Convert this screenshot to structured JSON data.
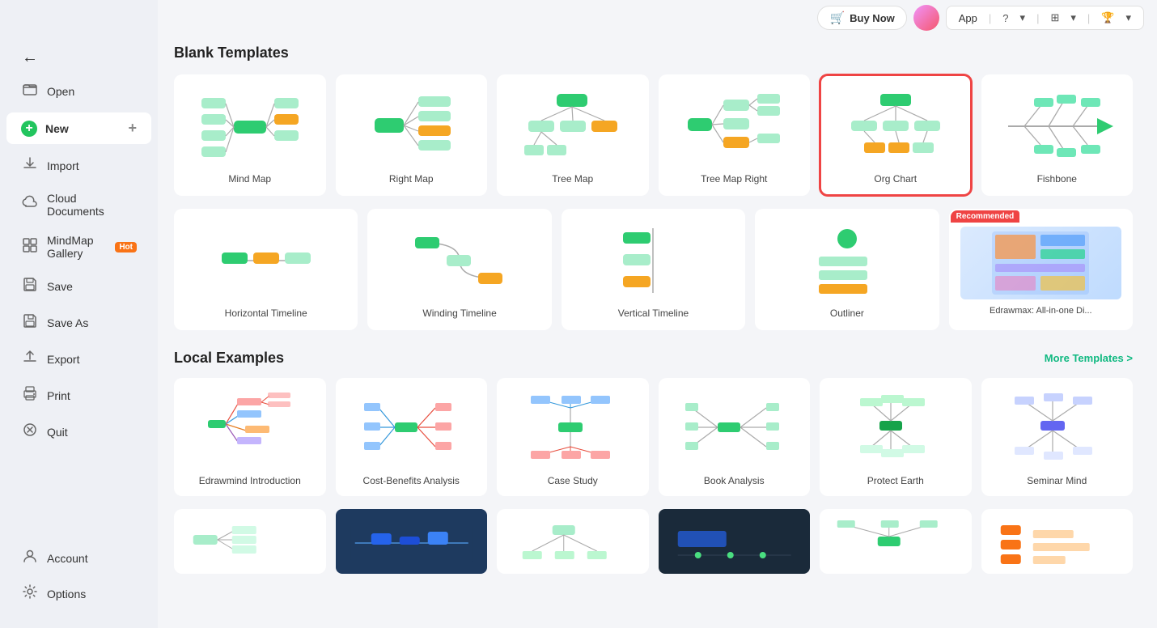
{
  "topbar": {
    "buy_now": "Buy Now",
    "app_label": "App",
    "help_icon": "?",
    "grid_icon": "⊞",
    "cup_icon": "🏆"
  },
  "sidebar": {
    "back_label": "←",
    "items": [
      {
        "id": "open",
        "label": "Open",
        "icon": "📂"
      },
      {
        "id": "new",
        "label": "New",
        "icon": "new",
        "active": true
      },
      {
        "id": "import",
        "label": "Import",
        "icon": "⬇"
      },
      {
        "id": "cloud",
        "label": "Cloud Documents",
        "icon": "☁"
      },
      {
        "id": "gallery",
        "label": "MindMap Gallery",
        "icon": "🖼",
        "badge": "Hot"
      },
      {
        "id": "save",
        "label": "Save",
        "icon": "💾"
      },
      {
        "id": "save-as",
        "label": "Save As",
        "icon": "📋"
      },
      {
        "id": "export",
        "label": "Export",
        "icon": "📤"
      },
      {
        "id": "print",
        "label": "Print",
        "icon": "🖨"
      },
      {
        "id": "quit",
        "label": "Quit",
        "icon": "✖"
      }
    ],
    "bottom_items": [
      {
        "id": "account",
        "label": "Account",
        "icon": "👤"
      },
      {
        "id": "options",
        "label": "Options",
        "icon": "⚙"
      }
    ]
  },
  "blank_templates": {
    "section_title": "Blank Templates",
    "items": [
      {
        "id": "mind-map",
        "label": "Mind Map"
      },
      {
        "id": "right-map",
        "label": "Right Map"
      },
      {
        "id": "tree-map",
        "label": "Tree Map"
      },
      {
        "id": "tree-map-right",
        "label": "Tree Map Right"
      },
      {
        "id": "org-chart",
        "label": "Org Chart",
        "selected": true
      },
      {
        "id": "fishbone",
        "label": "Fishbone"
      }
    ]
  },
  "blank_templates_row2": {
    "items": [
      {
        "id": "horizontal-timeline",
        "label": "Horizontal Timeline"
      },
      {
        "id": "winding-timeline",
        "label": "Winding Timeline"
      },
      {
        "id": "vertical-timeline",
        "label": "Vertical Timeline"
      },
      {
        "id": "outliner",
        "label": "Outliner"
      },
      {
        "id": "edrawmax",
        "label": "Edrawmax: All-in-one Di...",
        "recommended": true
      }
    ]
  },
  "local_examples": {
    "section_title": "Local Examples",
    "more_link": "More Templates >",
    "items": [
      {
        "id": "edrawmind-intro",
        "label": "Edrawmind Introduction"
      },
      {
        "id": "cost-benefits",
        "label": "Cost-Benefits Analysis"
      },
      {
        "id": "case-study",
        "label": "Case Study"
      },
      {
        "id": "book-analysis",
        "label": "Book Analysis"
      },
      {
        "id": "protect-earth",
        "label": "Protect Earth"
      },
      {
        "id": "seminar-mind",
        "label": "Seminar Mind"
      }
    ]
  }
}
